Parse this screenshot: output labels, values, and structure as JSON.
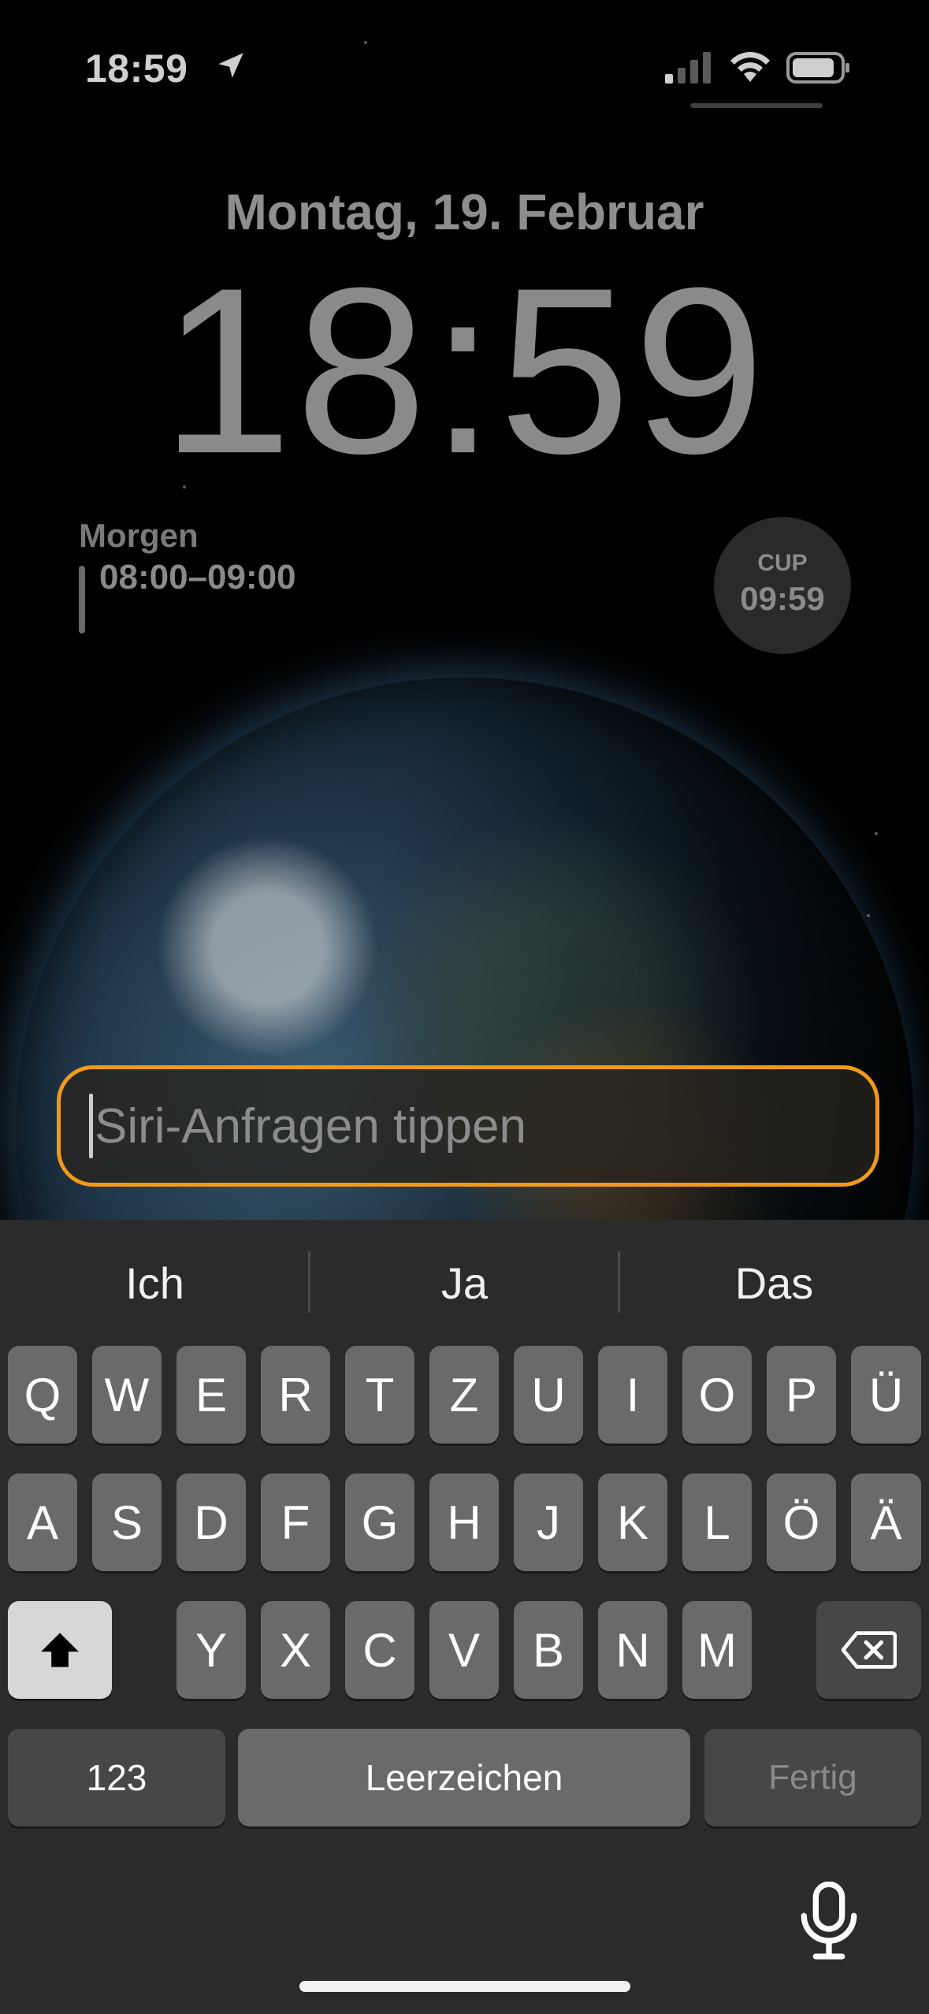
{
  "status_bar": {
    "time": "18:59",
    "icons": [
      "location-arrow-icon",
      "cellular-signal-icon",
      "wifi-icon",
      "battery-icon"
    ]
  },
  "lock_screen": {
    "date": "Montag, 19. Februar",
    "time": "18:59",
    "calendar_widget": {
      "title": "Morgen",
      "time_range": "08:00–09:00"
    },
    "circular_widget": {
      "label": "CUP",
      "time": "09:59"
    }
  },
  "siri": {
    "placeholder": "Siri-Anfragen tippen",
    "accent_color": "#f19a1a"
  },
  "keyboard": {
    "suggestions": [
      "Ich",
      "Ja",
      "Das"
    ],
    "row1": [
      "Q",
      "W",
      "E",
      "R",
      "T",
      "Z",
      "U",
      "I",
      "O",
      "P",
      "Ü"
    ],
    "row2": [
      "A",
      "S",
      "D",
      "F",
      "G",
      "H",
      "J",
      "K",
      "L",
      "Ö",
      "Ä"
    ],
    "row3": [
      "Y",
      "X",
      "C",
      "V",
      "B",
      "N",
      "M"
    ],
    "numbers_key": "123",
    "space_key": "Leerzeichen",
    "done_key": "Fertig",
    "icons": [
      "shift-icon",
      "delete-icon",
      "microphone-icon"
    ]
  }
}
